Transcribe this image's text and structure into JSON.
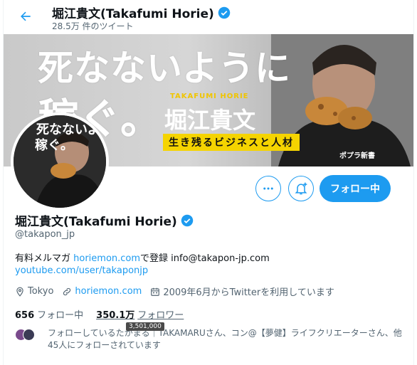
{
  "header": {
    "name": "堀江貴文(Takafumi Horie)",
    "tweet_count": "28.5万 件のツイート"
  },
  "banner": {
    "title_line1": "死なないように",
    "title_line2": "稼ぐ。",
    "author_en": "TAKAFUMI HORIE",
    "author_jp": "堀江貴文",
    "tagline": "生き残るビジネスと人材",
    "publisher": "ポプラ新書"
  },
  "avatar": {
    "text_line1": "死なないように",
    "text_line2": "稼ぐ。"
  },
  "actions": {
    "follow_label": "フォロー中"
  },
  "profile": {
    "name": "堀江貴文(Takafumi Horie)",
    "handle": "@takapon_jp",
    "bio_prefix": "有料メルマガ ",
    "bio_link1": "horiemon.com",
    "bio_suffix": "で登録 info@takapon-jp.com",
    "bio_link2": "youtube.com/user/takaponjp",
    "location": "Tokyo",
    "website": "horiemon.com",
    "joined": "2009年6月からTwitterを利用しています"
  },
  "stats": {
    "following_count": "656",
    "following_label": "フォロー中",
    "followers_count": "350.1万",
    "followers_label": "フォロワー",
    "tooltip": "3,501,000"
  },
  "followed_by": {
    "text": "フォローしているたかまる｜TAKAMARUさん、コン@【夢健】ライフクリエーターさん、他45人にフォローされています"
  },
  "colors": {
    "accent": "#1d9bf0",
    "banner_yellow": "#f5d400"
  }
}
